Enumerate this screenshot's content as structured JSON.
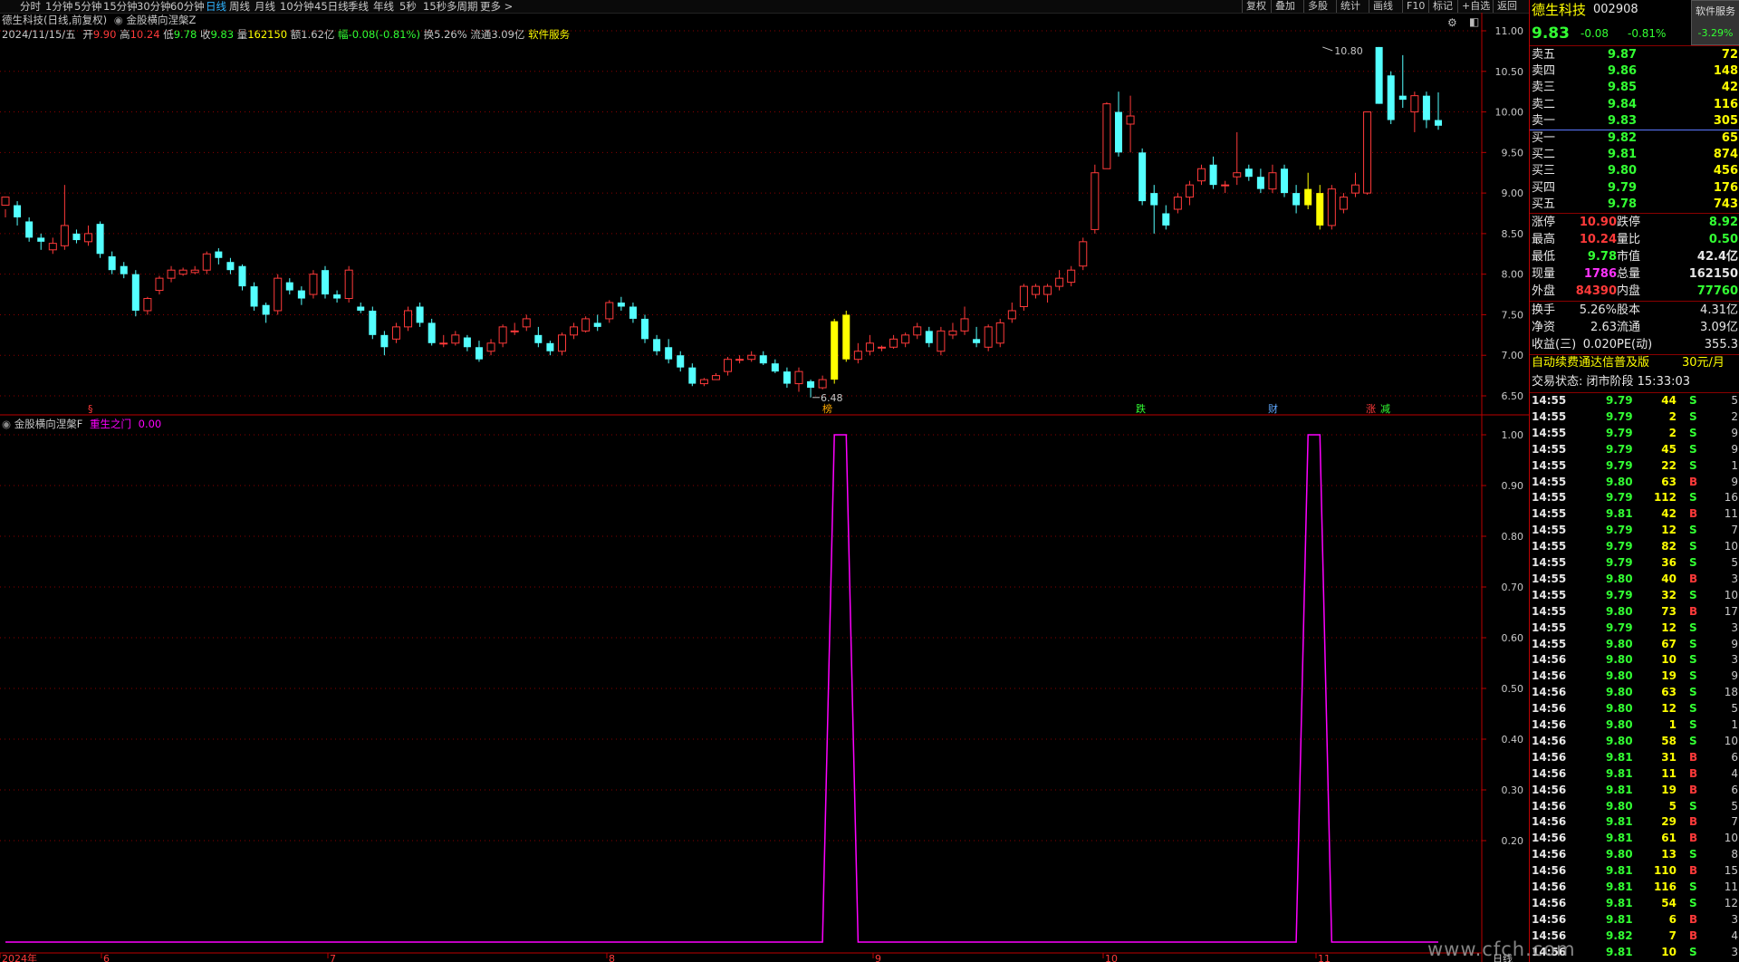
{
  "toolbar": {
    "tabs": [
      "分时",
      "1分钟",
      "5分钟",
      "15分钟",
      "30分钟",
      "60分钟",
      "日线",
      "周线",
      "月线",
      "10分钟",
      "45日线",
      "季线",
      "年线",
      "5秒",
      "15秒",
      "多周期",
      "更多 >"
    ],
    "active_tab": "日线",
    "right_buttons": [
      "复权",
      "叠加",
      "多股",
      "统计",
      "画线",
      "F10",
      "标记",
      "+自选",
      "返回"
    ]
  },
  "main_header": {
    "line1_stock": "德生科技(日线,前复权)",
    "line1_indicator": "金股横向涅槃Z",
    "date": "2024/11/15/五",
    "open_label": "开",
    "open": "9.90",
    "high_label": "高",
    "high": "10.24",
    "low_label": "低",
    "low": "9.78",
    "close_label": "收",
    "close": "9.83",
    "vol_label": "量",
    "vol": "162150",
    "amount": "额1.62亿",
    "change": "幅-0.08(-0.81%)",
    "turnover": "换5.26%",
    "float": "流通3.09亿",
    "service": "软件服务"
  },
  "sub_header": {
    "indicator": "金股横向涅槃F",
    "label": "重生之门",
    "value": "0.00"
  },
  "main_axis": [
    "11.00",
    "10.50",
    "10.00",
    "9.50",
    "9.00",
    "8.50",
    "8.00",
    "7.50",
    "7.00",
    "6.50"
  ],
  "sub_axis": [
    "1.00",
    "0.90",
    "0.80",
    "0.70",
    "0.60",
    "0.50",
    "0.40",
    "0.30",
    "0.20"
  ],
  "x_axis": [
    "2024年",
    "6",
    "7",
    "8",
    "9",
    "10",
    "11"
  ],
  "x_axis_right": "日线",
  "price_marks": {
    "high": "10.80",
    "low": "6.48"
  },
  "event_marks": [
    "§",
    "榜",
    "跌",
    "财",
    "涨",
    "减"
  ],
  "colors": {
    "up": "#ff3a3a",
    "down": "#54ffff",
    "highlight": "#ffff00",
    "signal": "#ff00ff",
    "grid": "#8a0000"
  },
  "chart_data": {
    "type": "candlestick",
    "ylim": [
      6.5,
      11.0
    ],
    "candles": [
      [
        8.85,
        8.95,
        8.7,
        8.8
      ],
      [
        8.85,
        8.7,
        8.6,
        8.9
      ],
      [
        8.65,
        8.45,
        8.4,
        8.7
      ],
      [
        8.45,
        8.4,
        8.3,
        8.5
      ],
      [
        8.3,
        8.38,
        8.25,
        8.45
      ],
      [
        8.35,
        8.6,
        8.3,
        9.1
      ],
      [
        8.5,
        8.42,
        8.38,
        8.55
      ],
      [
        8.4,
        8.5,
        8.35,
        8.6
      ],
      [
        8.62,
        8.25,
        8.2,
        8.65
      ],
      [
        8.22,
        8.05,
        8.0,
        8.28
      ],
      [
        8.1,
        8.0,
        7.95,
        8.15
      ],
      [
        8.0,
        7.55,
        7.48,
        8.05
      ],
      [
        7.55,
        7.7,
        7.5,
        7.72
      ],
      [
        7.8,
        7.95,
        7.75,
        7.98
      ],
      [
        7.95,
        8.05,
        7.9,
        8.1
      ],
      [
        8.0,
        8.05,
        7.98,
        8.08
      ],
      [
        8.02,
        8.05,
        8.0,
        8.1
      ],
      [
        8.05,
        8.25,
        8.0,
        8.28
      ],
      [
        8.28,
        8.2,
        8.12,
        8.32
      ],
      [
        8.15,
        8.05,
        8.0,
        8.2
      ],
      [
        8.1,
        7.85,
        7.8,
        8.12
      ],
      [
        7.85,
        7.6,
        7.55,
        7.9
      ],
      [
        7.62,
        7.5,
        7.4,
        7.65
      ],
      [
        7.55,
        7.95,
        7.5,
        8.0
      ],
      [
        7.9,
        7.8,
        7.75,
        7.95
      ],
      [
        7.8,
        7.7,
        7.62,
        7.85
      ],
      [
        7.75,
        8.0,
        7.7,
        8.05
      ],
      [
        8.05,
        7.75,
        7.7,
        8.1
      ],
      [
        7.75,
        7.7,
        7.65,
        7.8
      ],
      [
        7.7,
        8.05,
        7.65,
        8.1
      ],
      [
        7.6,
        7.55,
        7.52,
        7.65
      ],
      [
        7.55,
        7.25,
        7.2,
        7.6
      ],
      [
        7.25,
        7.1,
        7.0,
        7.3
      ],
      [
        7.2,
        7.35,
        7.15,
        7.4
      ],
      [
        7.35,
        7.55,
        7.3,
        7.6
      ],
      [
        7.6,
        7.4,
        7.35,
        7.65
      ],
      [
        7.4,
        7.15,
        7.12,
        7.45
      ],
      [
        7.15,
        7.15,
        7.1,
        7.25
      ],
      [
        7.15,
        7.25,
        7.12,
        7.3
      ],
      [
        7.22,
        7.1,
        7.05,
        7.25
      ],
      [
        7.1,
        6.95,
        6.92,
        7.18
      ],
      [
        7.05,
        7.15,
        7.0,
        7.2
      ],
      [
        7.15,
        7.35,
        7.1,
        7.38
      ],
      [
        7.3,
        7.3,
        7.25,
        7.4
      ],
      [
        7.35,
        7.45,
        7.3,
        7.5
      ],
      [
        7.25,
        7.15,
        7.1,
        7.35
      ],
      [
        7.15,
        7.05,
        7.0,
        7.18
      ],
      [
        7.05,
        7.25,
        7.0,
        7.28
      ],
      [
        7.25,
        7.35,
        7.2,
        7.4
      ],
      [
        7.3,
        7.45,
        7.28,
        7.48
      ],
      [
        7.4,
        7.35,
        7.3,
        7.5
      ],
      [
        7.45,
        7.65,
        7.4,
        7.68
      ],
      [
        7.65,
        7.6,
        7.55,
        7.72
      ],
      [
        7.6,
        7.45,
        7.4,
        7.65
      ],
      [
        7.45,
        7.2,
        7.15,
        7.5
      ],
      [
        7.2,
        7.05,
        7.0,
        7.25
      ],
      [
        7.1,
        6.95,
        6.9,
        7.2
      ],
      [
        7.0,
        6.85,
        6.8,
        7.05
      ],
      [
        6.85,
        6.65,
        6.62,
        6.9
      ],
      [
        6.65,
        6.7,
        6.62,
        6.72
      ],
      [
        6.7,
        6.75,
        6.7,
        6.78
      ],
      [
        6.8,
        6.95,
        6.75,
        6.98
      ],
      [
        6.95,
        6.95,
        6.9,
        7.0
      ],
      [
        6.95,
        7.0,
        6.92,
        7.05
      ],
      [
        7.0,
        6.9,
        6.88,
        7.05
      ],
      [
        6.9,
        6.8,
        6.78,
        6.95
      ],
      [
        6.8,
        6.65,
        6.6,
        6.85
      ],
      [
        6.65,
        6.8,
        6.55,
        6.85
      ],
      [
        6.68,
        6.6,
        6.48,
        6.7
      ],
      [
        6.6,
        6.7,
        6.58,
        6.75
      ],
      [
        6.7,
        7.42,
        6.65,
        7.45
      ],
      [
        7.5,
        6.95,
        6.92,
        7.55
      ],
      [
        6.95,
        7.05,
        6.9,
        7.15
      ],
      [
        7.05,
        7.15,
        7.0,
        7.25
      ],
      [
        7.1,
        7.1,
        7.05,
        7.12
      ],
      [
        7.1,
        7.2,
        7.08,
        7.25
      ],
      [
        7.15,
        7.25,
        7.1,
        7.28
      ],
      [
        7.25,
        7.35,
        7.2,
        7.4
      ],
      [
        7.3,
        7.15,
        7.1,
        7.35
      ],
      [
        7.05,
        7.3,
        7.0,
        7.35
      ],
      [
        7.25,
        7.3,
        7.2,
        7.4
      ],
      [
        7.3,
        7.45,
        7.25,
        7.6
      ],
      [
        7.2,
        7.15,
        7.1,
        7.35
      ],
      [
        7.1,
        7.35,
        7.05,
        7.38
      ],
      [
        7.15,
        7.4,
        7.1,
        7.45
      ],
      [
        7.45,
        7.55,
        7.4,
        7.65
      ],
      [
        7.6,
        7.85,
        7.55,
        7.88
      ],
      [
        7.75,
        7.85,
        7.7,
        7.88
      ],
      [
        7.75,
        7.85,
        7.65,
        7.88
      ],
      [
        7.85,
        7.95,
        7.8,
        8.05
      ],
      [
        7.9,
        8.05,
        7.85,
        8.1
      ],
      [
        8.1,
        8.4,
        8.05,
        8.45
      ],
      [
        8.55,
        9.25,
        8.5,
        9.35
      ],
      [
        9.3,
        10.1,
        9.3,
        10.12
      ],
      [
        10.0,
        9.5,
        9.45,
        10.25
      ],
      [
        9.85,
        9.95,
        9.5,
        10.2
      ],
      [
        9.5,
        8.9,
        8.85,
        9.55
      ],
      [
        9.0,
        8.85,
        8.5,
        9.1
      ],
      [
        8.75,
        8.6,
        8.55,
        8.85
      ],
      [
        8.8,
        8.95,
        8.75,
        9.0
      ],
      [
        8.95,
        9.1,
        8.85,
        9.15
      ],
      [
        9.15,
        9.3,
        9.1,
        9.35
      ],
      [
        9.35,
        9.1,
        9.05,
        9.45
      ],
      [
        9.1,
        9.1,
        9.0,
        9.15
      ],
      [
        9.2,
        9.25,
        9.1,
        9.75
      ],
      [
        9.3,
        9.2,
        9.15,
        9.35
      ],
      [
        9.2,
        9.05,
        9.0,
        9.3
      ],
      [
        9.05,
        9.25,
        9.0,
        9.35
      ],
      [
        9.3,
        9.0,
        8.95,
        9.35
      ],
      [
        9.0,
        8.85,
        8.75,
        9.1
      ],
      [
        8.85,
        9.05,
        8.8,
        9.25
      ],
      [
        9.0,
        8.6,
        8.55,
        9.1
      ],
      [
        8.6,
        9.05,
        8.55,
        9.1
      ],
      [
        8.8,
        8.95,
        8.75,
        9.0
      ],
      [
        9.0,
        9.1,
        8.95,
        9.25
      ],
      [
        9.0,
        10.0,
        8.98,
        10.0
      ],
      [
        10.8,
        10.1,
        10.1,
        10.8
      ],
      [
        10.45,
        9.9,
        9.85,
        10.5
      ],
      [
        10.2,
        10.15,
        10.05,
        10.7
      ],
      [
        10.0,
        10.2,
        9.75,
        10.25
      ],
      [
        10.2,
        9.9,
        9.8,
        10.25
      ],
      [
        9.9,
        9.83,
        9.78,
        10.24
      ]
    ],
    "highlighted_candles": [
      70,
      71,
      110,
      111
    ],
    "signal_series": {
      "name": "重生之门",
      "peaks": [
        [
          70,
          71
        ],
        [
          110,
          111
        ]
      ],
      "range": [
        0,
        1
      ]
    }
  },
  "quote": {
    "name": "德生科技",
    "code": "002908",
    "tag": "软件服务",
    "tag_pct": "-3.29%",
    "price": "9.83",
    "change": "-0.08",
    "pct": "-0.81%",
    "asks": [
      {
        "label": "卖五",
        "price": "9.87",
        "vol": "72"
      },
      {
        "label": "卖四",
        "price": "9.86",
        "vol": "148"
      },
      {
        "label": "卖三",
        "price": "9.85",
        "vol": "42"
      },
      {
        "label": "卖二",
        "price": "9.84",
        "vol": "116"
      },
      {
        "label": "卖一",
        "price": "9.83",
        "vol": "305"
      }
    ],
    "bids": [
      {
        "label": "买一",
        "price": "9.82",
        "vol": "65"
      },
      {
        "label": "买二",
        "price": "9.81",
        "vol": "874"
      },
      {
        "label": "买三",
        "price": "9.80",
        "vol": "456"
      },
      {
        "label": "买四",
        "price": "9.79",
        "vol": "176"
      },
      {
        "label": "买五",
        "price": "9.78",
        "vol": "743"
      }
    ],
    "stats": [
      {
        "l1": "涨停",
        "v1": "10.90",
        "c1": "#ff3a3a",
        "l2": "跌停",
        "v2": "8.92",
        "c2": "#33ff33"
      },
      {
        "l1": "最高",
        "v1": "10.24",
        "c1": "#ff3a3a",
        "l2": "量比",
        "v2": "0.50",
        "c2": "#33ff33"
      },
      {
        "l1": "最低",
        "v1": "9.78",
        "c1": "#33ff33",
        "l2": "市值",
        "v2": "42.4亿",
        "c2": "#e6e6e6"
      },
      {
        "l1": "现量",
        "v1": "1786",
        "c1": "#ff33ff",
        "l2": "总量",
        "v2": "162150",
        "c2": "#e6e6e6"
      },
      {
        "l1": "外盘",
        "v1": "84390",
        "c1": "#ff3a3a",
        "l2": "内盘",
        "v2": "77760",
        "c2": "#33ff33"
      }
    ],
    "stats2": [
      {
        "l1": "换手",
        "v1": "5.26%",
        "l2": "股本",
        "v2": "4.31亿"
      },
      {
        "l1": "净资",
        "v1": "2.63",
        "l2": "流通",
        "v2": "3.09亿"
      },
      {
        "l1": "收益(三)",
        "v1": "0.020",
        "l2": "PE(动)",
        "v2": "355.3"
      }
    ],
    "promo": "自动续费通达信普及版",
    "promo_price": "30元/月",
    "status": "交易状态: 闭市阶段 15:33:03"
  },
  "ticks": [
    [
      "14:55",
      "9.79",
      "44",
      "S",
      "5"
    ],
    [
      "14:55",
      "9.79",
      "2",
      "S",
      "2"
    ],
    [
      "14:55",
      "9.79",
      "2",
      "S",
      "9"
    ],
    [
      "14:55",
      "9.79",
      "45",
      "S",
      "9"
    ],
    [
      "14:55",
      "9.79",
      "22",
      "S",
      "1"
    ],
    [
      "14:55",
      "9.80",
      "63",
      "B",
      "9"
    ],
    [
      "14:55",
      "9.79",
      "112",
      "S",
      "16"
    ],
    [
      "14:55",
      "9.81",
      "42",
      "B",
      "11"
    ],
    [
      "14:55",
      "9.79",
      "12",
      "S",
      "7"
    ],
    [
      "14:55",
      "9.79",
      "82",
      "S",
      "10"
    ],
    [
      "14:55",
      "9.79",
      "36",
      "S",
      "5"
    ],
    [
      "14:55",
      "9.80",
      "40",
      "B",
      "3"
    ],
    [
      "14:55",
      "9.79",
      "32",
      "S",
      "10"
    ],
    [
      "14:55",
      "9.80",
      "73",
      "B",
      "17"
    ],
    [
      "14:55",
      "9.79",
      "12",
      "S",
      "3"
    ],
    [
      "14:55",
      "9.80",
      "67",
      "S",
      "9"
    ],
    [
      "14:56",
      "9.80",
      "10",
      "S",
      "3"
    ],
    [
      "14:56",
      "9.80",
      "19",
      "S",
      "9"
    ],
    [
      "14:56",
      "9.80",
      "63",
      "S",
      "18"
    ],
    [
      "14:56",
      "9.80",
      "12",
      "S",
      "5"
    ],
    [
      "14:56",
      "9.80",
      "1",
      "S",
      "1"
    ],
    [
      "14:56",
      "9.80",
      "58",
      "S",
      "10"
    ],
    [
      "14:56",
      "9.81",
      "31",
      "B",
      "6"
    ],
    [
      "14:56",
      "9.81",
      "11",
      "B",
      "4"
    ],
    [
      "14:56",
      "9.81",
      "19",
      "B",
      "6"
    ],
    [
      "14:56",
      "9.80",
      "5",
      "S",
      "5"
    ],
    [
      "14:56",
      "9.81",
      "29",
      "B",
      "7"
    ],
    [
      "14:56",
      "9.81",
      "61",
      "B",
      "10"
    ],
    [
      "14:56",
      "9.80",
      "13",
      "S",
      "8"
    ],
    [
      "14:56",
      "9.81",
      "110",
      "B",
      "15"
    ],
    [
      "14:56",
      "9.81",
      "116",
      "S",
      "11"
    ],
    [
      "14:56",
      "9.81",
      "54",
      "S",
      "12"
    ],
    [
      "14:56",
      "9.81",
      "6",
      "B",
      "3"
    ],
    [
      "14:56",
      "9.82",
      "7",
      "B",
      "4"
    ],
    [
      "14:56",
      "9.81",
      "10",
      "S",
      "3"
    ]
  ],
  "watermark": "www.cfch.com"
}
